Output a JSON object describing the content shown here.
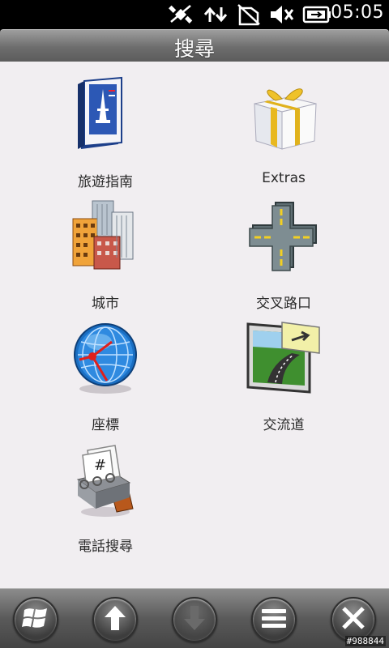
{
  "status_bar": {
    "time": "05:05",
    "icons": [
      "satellite-off-icon",
      "sync-icon",
      "no-sim-icon",
      "volume-mute-icon",
      "battery-charging-icon"
    ]
  },
  "header": {
    "title": "搜尋"
  },
  "tiles": [
    {
      "label": "旅遊指南",
      "icon": "travel-guide-book-icon"
    },
    {
      "label": "Extras",
      "icon": "gift-box-icon"
    },
    {
      "label": "城市",
      "icon": "city-buildings-icon"
    },
    {
      "label": "交叉路口",
      "icon": "intersection-icon"
    },
    {
      "label": "座標",
      "icon": "globe-coordinates-icon"
    },
    {
      "label": "交流道",
      "icon": "highway-exit-icon"
    },
    {
      "label": "電話搜尋",
      "icon": "rolodex-icon"
    }
  ],
  "toolbar": {
    "buttons": [
      "windows-start",
      "up-arrow",
      "down-arrow",
      "menu",
      "close"
    ]
  },
  "watermark": "#988844",
  "colors": {
    "content_bg": "#f1eef1",
    "label_text": "#2a2a2a",
    "status_bg": "#000000"
  }
}
